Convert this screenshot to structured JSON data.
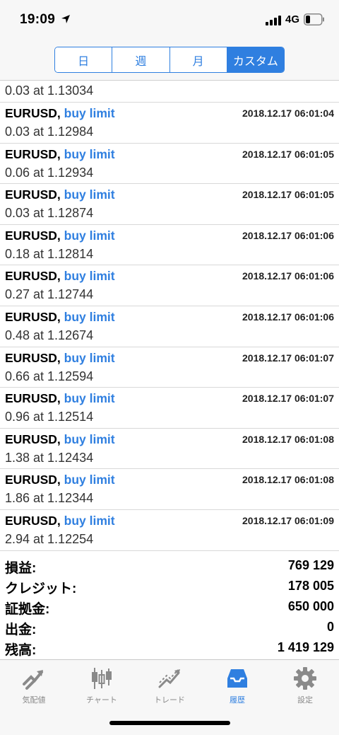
{
  "status_bar": {
    "time": "19:09",
    "network": "4G"
  },
  "period_tabs": [
    {
      "label": "日",
      "active": false
    },
    {
      "label": "週",
      "active": false
    },
    {
      "label": "月",
      "active": false
    },
    {
      "label": "カスタム",
      "active": true
    }
  ],
  "first_partial_detail": "0.03 at 1.13034",
  "orders": [
    {
      "symbol": "EURUSD,",
      "type": "buy limit",
      "time": "2018.12.17 06:01:04",
      "detail": "0.03 at 1.12984"
    },
    {
      "symbol": "EURUSD,",
      "type": "buy limit",
      "time": "2018.12.17 06:01:05",
      "detail": "0.06 at 1.12934"
    },
    {
      "symbol": "EURUSD,",
      "type": "buy limit",
      "time": "2018.12.17 06:01:05",
      "detail": "0.03 at 1.12874"
    },
    {
      "symbol": "EURUSD,",
      "type": "buy limit",
      "time": "2018.12.17 06:01:06",
      "detail": "0.18 at 1.12814"
    },
    {
      "symbol": "EURUSD,",
      "type": "buy limit",
      "time": "2018.12.17 06:01:06",
      "detail": "0.27 at 1.12744"
    },
    {
      "symbol": "EURUSD,",
      "type": "buy limit",
      "time": "2018.12.17 06:01:06",
      "detail": "0.48 at 1.12674"
    },
    {
      "symbol": "EURUSD,",
      "type": "buy limit",
      "time": "2018.12.17 06:01:07",
      "detail": "0.66 at 1.12594"
    },
    {
      "symbol": "EURUSD,",
      "type": "buy limit",
      "time": "2018.12.17 06:01:07",
      "detail": "0.96 at 1.12514"
    },
    {
      "symbol": "EURUSD,",
      "type": "buy limit",
      "time": "2018.12.17 06:01:08",
      "detail": "1.38 at 1.12434"
    },
    {
      "symbol": "EURUSD,",
      "type": "buy limit",
      "time": "2018.12.17 06:01:08",
      "detail": "1.86 at 1.12344"
    },
    {
      "symbol": "EURUSD,",
      "type": "buy limit",
      "time": "2018.12.17 06:01:09",
      "detail": "2.94 at 1.12254"
    }
  ],
  "summary": [
    {
      "label": "損益:",
      "value": "769 129"
    },
    {
      "label": "クレジット:",
      "value": "178 005"
    },
    {
      "label": "証拠金:",
      "value": "650 000"
    },
    {
      "label": "出金:",
      "value": "0"
    },
    {
      "label": "残高:",
      "value": "1 419 129"
    }
  ],
  "tabbar": [
    {
      "label": "気配値",
      "icon": "quotes-icon",
      "active": false
    },
    {
      "label": "チャート",
      "icon": "chart-icon",
      "active": false
    },
    {
      "label": "トレード",
      "icon": "trade-icon",
      "active": false
    },
    {
      "label": "履歴",
      "icon": "history-icon",
      "active": true
    },
    {
      "label": "設定",
      "icon": "settings-icon",
      "active": false
    }
  ],
  "colors": {
    "accent": "#2f7fe0",
    "inactive": "#8a8a8a",
    "text": "#000000"
  }
}
